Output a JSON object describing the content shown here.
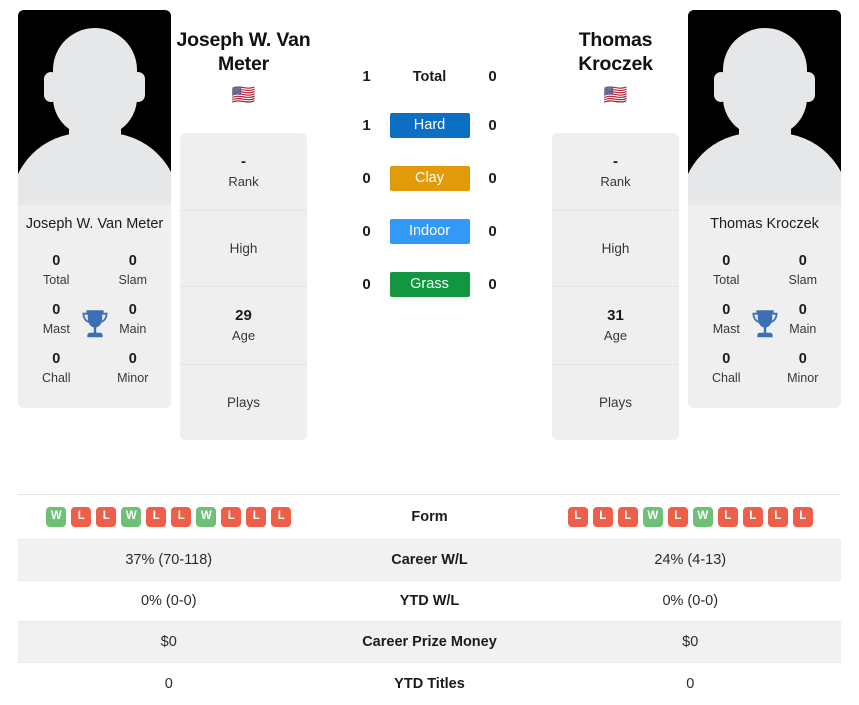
{
  "players": {
    "left": {
      "name": "Joseph W. Van Meter",
      "card_name": "Joseph W. Van Meter",
      "flag": "🇺🇸",
      "flag_name": "united-states-flag",
      "rank": "-",
      "rank_label": "Rank",
      "high_label": "High",
      "high_value": "",
      "age": "29",
      "age_label": "Age",
      "plays_label": "Plays",
      "plays_value": "",
      "titles": [
        {
          "num": "0",
          "label": "Total"
        },
        {
          "num": "0",
          "label": "Slam"
        },
        {
          "num": "0",
          "label": "Mast"
        },
        {
          "num": "0",
          "label": "Main"
        },
        {
          "num": "0",
          "label": "Chall"
        },
        {
          "num": "0",
          "label": "Minor"
        }
      ],
      "form": [
        "W",
        "L",
        "L",
        "W",
        "L",
        "L",
        "W",
        "L",
        "L",
        "L"
      ],
      "career_wl": "37% (70-118)",
      "ytd_wl": "0% (0-0)",
      "career_prize": "$0",
      "ytd_titles": "0"
    },
    "right": {
      "name": "Thomas Kroczek",
      "card_name": "Thomas Kroczek",
      "flag": "🇺🇸",
      "flag_name": "united-states-flag",
      "rank": "-",
      "rank_label": "Rank",
      "high_label": "High",
      "high_value": "",
      "age": "31",
      "age_label": "Age",
      "plays_label": "Plays",
      "plays_value": "",
      "titles": [
        {
          "num": "0",
          "label": "Total"
        },
        {
          "num": "0",
          "label": "Slam"
        },
        {
          "num": "0",
          "label": "Mast"
        },
        {
          "num": "0",
          "label": "Main"
        },
        {
          "num": "0",
          "label": "Chall"
        },
        {
          "num": "0",
          "label": "Minor"
        }
      ],
      "form": [
        "L",
        "L",
        "L",
        "W",
        "L",
        "W",
        "L",
        "L",
        "L",
        "L"
      ],
      "career_wl": "24% (4-13)",
      "ytd_wl": "0% (0-0)",
      "career_prize": "$0",
      "ytd_titles": "0"
    }
  },
  "head_to_head": [
    {
      "left": "1",
      "label": "Total",
      "right": "0",
      "type": "text"
    },
    {
      "left": "1",
      "label": "Hard",
      "right": "0",
      "type": "badge",
      "color": "#0d6fc4"
    },
    {
      "left": "0",
      "label": "Clay",
      "right": "0",
      "type": "badge",
      "color": "#e09a0a"
    },
    {
      "left": "0",
      "label": "Indoor",
      "right": "0",
      "type": "badge",
      "color": "#3399f7"
    },
    {
      "left": "0",
      "label": "Grass",
      "right": "0",
      "type": "badge",
      "color": "#11973f"
    }
  ],
  "comparison_rows": [
    {
      "key": "form",
      "label": "Form"
    },
    {
      "key": "career_wl",
      "label": "Career W/L"
    },
    {
      "key": "ytd_wl",
      "label": "YTD W/L"
    },
    {
      "key": "career_prize",
      "label": "Career Prize Money"
    },
    {
      "key": "ytd_titles",
      "label": "YTD Titles"
    }
  ],
  "colors": {
    "win": "#6ec077",
    "loss": "#ee5f4a",
    "trophy": "#3d6fb4",
    "panel": "#efefef",
    "row_shade": "#f1f1f1"
  }
}
